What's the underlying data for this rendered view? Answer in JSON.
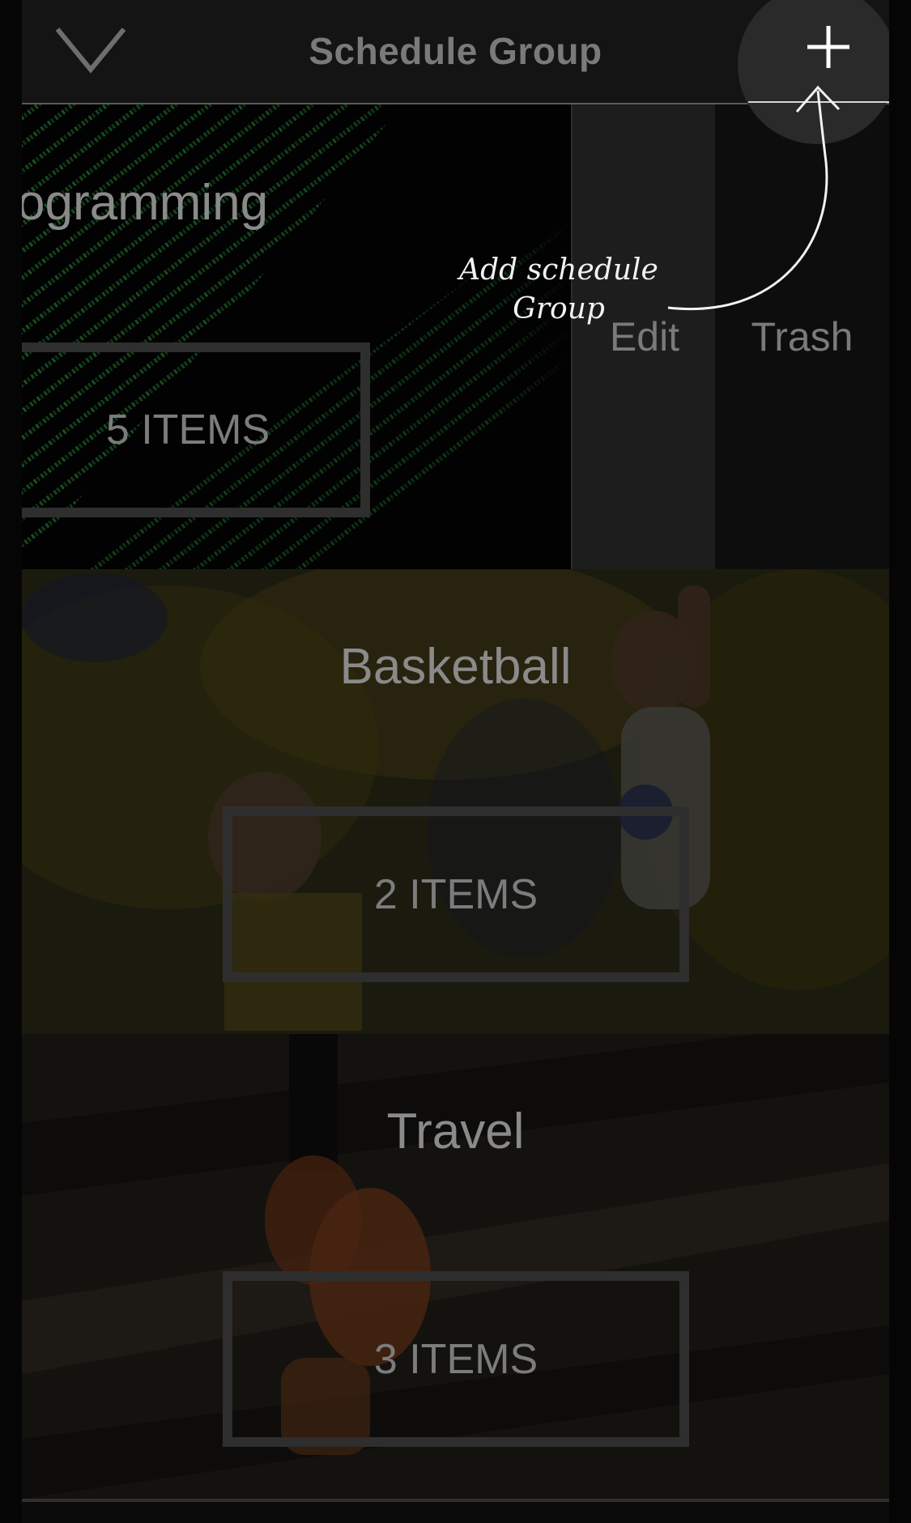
{
  "header": {
    "title": "Schedule Group",
    "back_icon": "chevron-down-icon",
    "add_icon": "plus-icon"
  },
  "groups": [
    {
      "title": "ogramming",
      "items": "5 ITEMS"
    },
    {
      "title": "Basketball",
      "items": "2 ITEMS"
    },
    {
      "title": "Travel",
      "items": "3 ITEMS"
    }
  ],
  "swipe_actions": {
    "edit": "Edit",
    "trash": "Trash"
  },
  "annotation": {
    "line1": "Add schedule",
    "line2": "Group"
  },
  "colors": {
    "background": "#0b0b0b",
    "header": "#141414",
    "annotation": "#f2f2f2",
    "code_text": "#1f6b2c"
  }
}
